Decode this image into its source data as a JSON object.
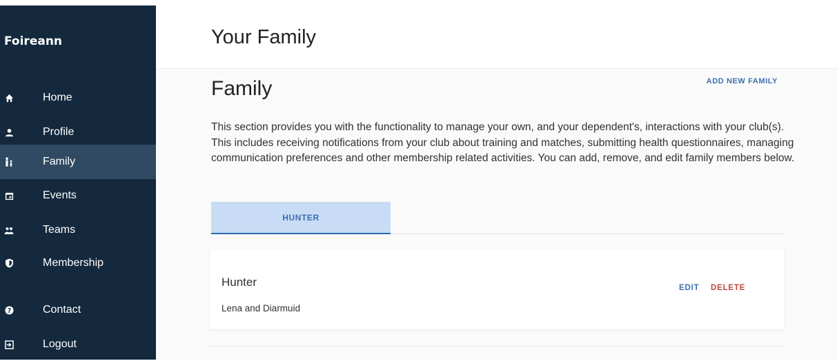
{
  "app": {
    "brand": "Foireann"
  },
  "sidebar": {
    "items": [
      {
        "label": "Home",
        "icon": "home-icon",
        "active": false
      },
      {
        "label": "Profile",
        "icon": "person-icon",
        "active": false
      },
      {
        "label": "Family",
        "icon": "family-icon",
        "active": true
      },
      {
        "label": "Events",
        "icon": "calendar-icon",
        "active": false
      },
      {
        "label": "Teams",
        "icon": "group-icon",
        "active": false
      },
      {
        "label": "Membership",
        "icon": "shield-icon",
        "active": false
      },
      {
        "label": "Contact",
        "icon": "help-icon",
        "active": false
      },
      {
        "label": "Logout",
        "icon": "logout-icon",
        "active": false
      }
    ]
  },
  "header": {
    "title": "Your Family"
  },
  "main": {
    "section_title": "Family",
    "add_label": "ADD NEW FAMILY",
    "description": "This section provides you with the functionality to manage your own, and your dependent's, interactions with your club(s). This includes receiving notifications from your club about training and matches, submitting health questionnaires, managing communication preferences and other membership related activities. You can add, remove, and edit family members below.",
    "tabs": [
      {
        "label": "HUNTER",
        "active": true
      }
    ],
    "card": {
      "name": "Hunter",
      "members": "Lena and Diarmuid",
      "edit_label": "EDIT",
      "delete_label": "DELETE"
    }
  },
  "colors": {
    "sidebar_bg": "#14293d",
    "sidebar_active": "#2f4a62",
    "accent": "#3b6fb0",
    "danger": "#c0453e",
    "tab_bg": "#c9dcf5"
  }
}
